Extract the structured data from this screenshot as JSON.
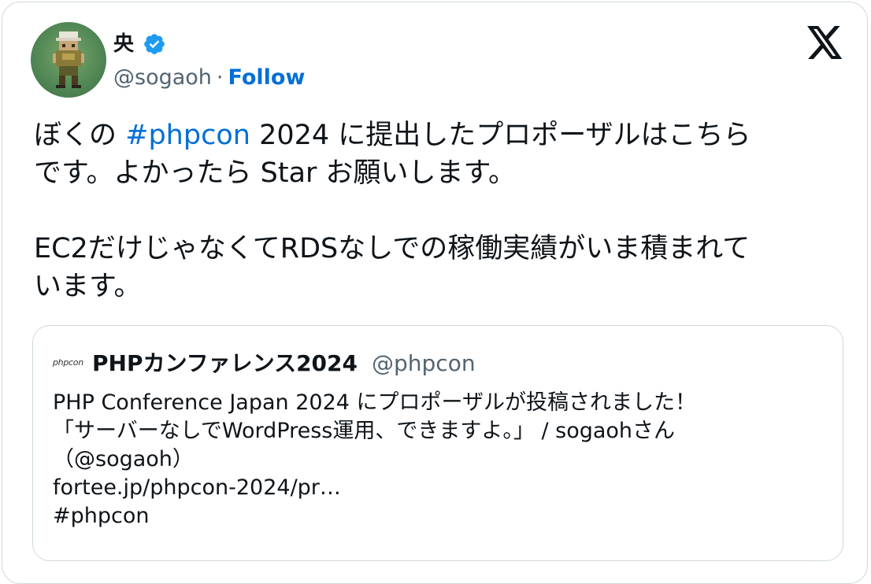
{
  "author": {
    "name": "央",
    "handle": "@sogaoh",
    "separator": "·",
    "follow_label": "Follow",
    "verified_icon": "verified-badge-icon",
    "avatar_icon": "pixel-art-character-avatar"
  },
  "platform_logo": "x-logo-icon",
  "tweet": {
    "line1_prefix": "ぼくの ",
    "line1_hashtag": "#phpcon",
    "line1_suffix": " 2024 に提出したプロポーザルはこちら",
    "line2": "です。よかったら Star お願いします。",
    "line3": "EC2だけじゃなくてRDSなしでの稼働実績がいま積まれて",
    "line4": "います。"
  },
  "quote": {
    "logo_text": "phpcon",
    "name": "PHPカンファレンス2024",
    "handle": "@phpcon",
    "lines": [
      "PHP Conference Japan 2024 にプロポーザルが投稿されました！",
      "「サーバーなしでWordPress運用、できますよ。」 / sogaohさん",
      "（@sogaoh）",
      "fortee.jp/phpcon-2024/pr…",
      "#phpcon"
    ]
  },
  "colors": {
    "link_blue": "#006fd6",
    "verified_blue": "#1d9bf0",
    "muted_gray": "#536471",
    "border": "#cfd9de",
    "text": "#0f1419"
  }
}
